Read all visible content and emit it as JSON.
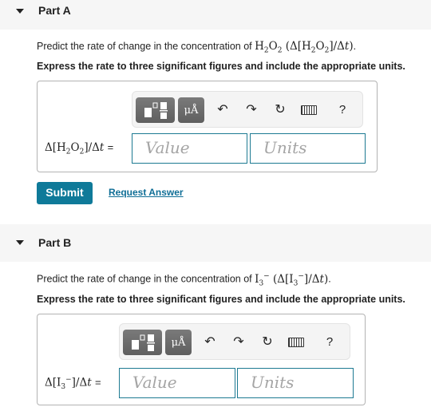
{
  "partA": {
    "title": "Part A",
    "prompt_prefix": "Predict the rate of change in the concentration of ",
    "species": "H2O2",
    "prompt_suffix": ".",
    "instruction": "Express the rate to three significant figures and include the appropriate units.",
    "value_placeholder": "Value",
    "units_placeholder": "Units"
  },
  "partB": {
    "title": "Part B",
    "prompt_prefix": "Predict the rate of change in the concentration of ",
    "species": "I3-",
    "prompt_suffix": ".",
    "instruction": "Express the rate to three significant figures and include the appropriate units.",
    "value_placeholder": "Value",
    "units_placeholder": "Units"
  },
  "toolbar": {
    "units_label": "μÅ",
    "help_label": "?",
    "icons": [
      "templates-icon",
      "units-icon",
      "undo-icon",
      "redo-icon",
      "reset-icon",
      "keyboard-icon",
      "help-icon"
    ]
  },
  "actions": {
    "submit_label": "Submit",
    "request_answer_label": "Request Answer"
  },
  "colors": {
    "accent": "#0f7a99",
    "field_border": "#1d7a92",
    "link": "#0f6e96"
  }
}
